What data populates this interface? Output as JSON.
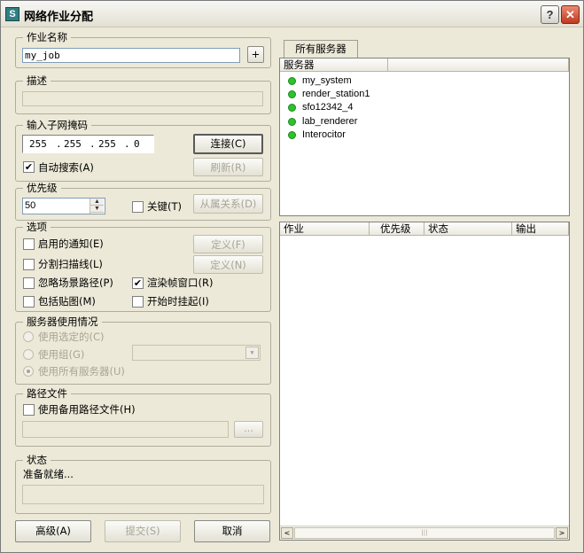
{
  "window": {
    "title": "网络作业分配",
    "help": "?",
    "close": "✕",
    "app_icon": "S"
  },
  "job_name": {
    "label": "作业名称",
    "value": "my_job",
    "add": "+"
  },
  "description": {
    "label": "描述",
    "value": ""
  },
  "subnet": {
    "label": "输入子网掩码",
    "octets": [
      "255",
      "255",
      "255",
      "0"
    ],
    "dot": ".",
    "connect": "连接(C)",
    "auto_search": "自动搜索(A)",
    "refresh": "刷新(R)"
  },
  "priority": {
    "label": "优先级",
    "value": "50",
    "critical": "关键(T)",
    "dependencies": "从属关系(D)"
  },
  "options": {
    "label": "选项",
    "enable_notify": "启用的通知(E)",
    "define_e": "定义(F)",
    "split_scan": "分割扫描线(L)",
    "define_n": "定义(N)",
    "ignore_scene_path": "忽略场景路径(P)",
    "render_frame_window": "渲染帧窗口(R)",
    "include_maps": "包括贴图(M)",
    "start_suspended": "开始时挂起(I)"
  },
  "server_usage": {
    "label": "服务器使用情况",
    "use_selected": "使用选定的(C)",
    "use_group": "使用组(G)",
    "use_all": "使用所有服务器(U)"
  },
  "path_file": {
    "label": "路径文件",
    "use_alt": "使用备用路径文件(H)",
    "browse": "..."
  },
  "status": {
    "label": "状态",
    "text": "准备就绪..."
  },
  "footer": {
    "advanced": "高级(A)",
    "submit": "提交(S)",
    "cancel": "取消"
  },
  "servers_panel": {
    "tab": "所有服务器",
    "column": "服务器",
    "items": [
      "my_system",
      "render_station1",
      "sfo12342_4",
      "lab_renderer",
      "Interocitor"
    ],
    "status_color": "#2ec12e"
  },
  "jobs_panel": {
    "columns": [
      "作业",
      "优先级",
      "状态",
      "输出"
    ],
    "scroll_left": "<",
    "scroll_right": ">",
    "grip": "|||"
  },
  "checked_mark": "✔"
}
